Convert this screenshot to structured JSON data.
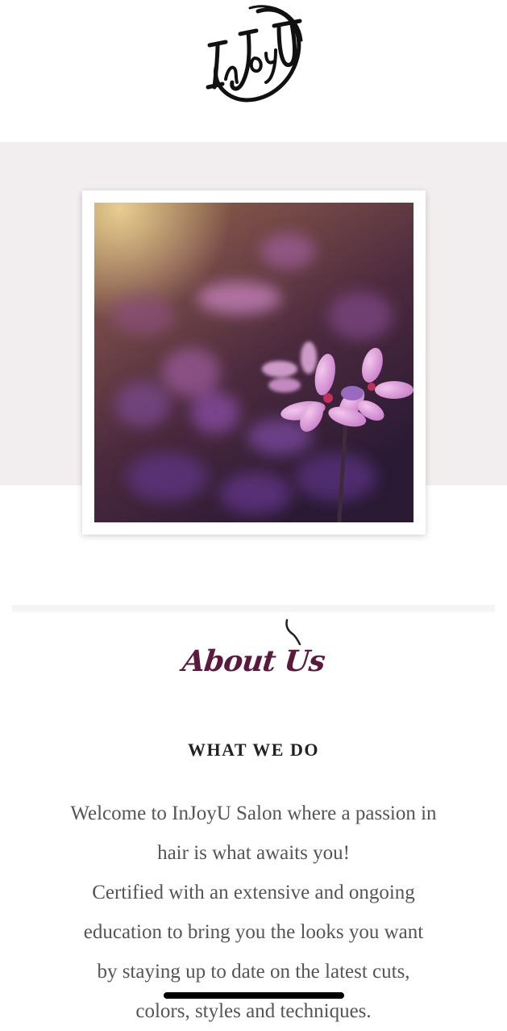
{
  "header": {
    "logo_text": "InJoyU"
  },
  "hero": {
    "image_subject": "purple flowers photo"
  },
  "about": {
    "title": "About Us",
    "subtitle": "WHAT WE DO",
    "paragraph_lines": [
      "Welcome to InJoyU Salon where a passion in",
      "hair is what awaits you!",
      "Certified with an extensive and ongoing",
      "education to bring you the looks you want",
      "by staying up to date on the latest cuts,",
      "colors, styles and techniques."
    ]
  },
  "colors": {
    "accent": "#5b1a3d",
    "band": "#f2eeef",
    "text": "#555555"
  }
}
